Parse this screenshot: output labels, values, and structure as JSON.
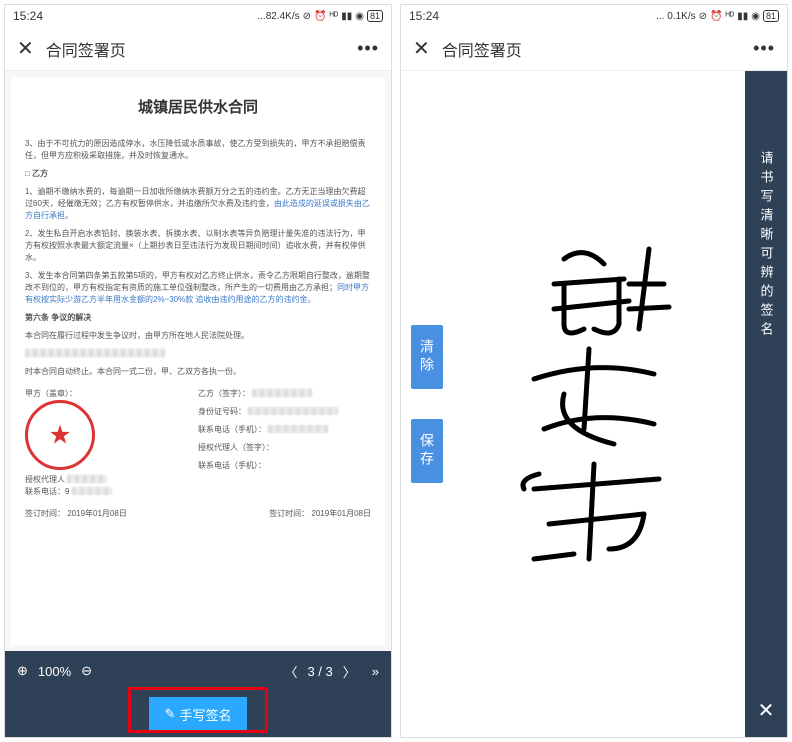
{
  "left": {
    "status": {
      "time": "15:24",
      "speed": "...82.4K/s",
      "battery": "81"
    },
    "header": {
      "title": "合同签署页"
    },
    "doc": {
      "title": "城镇居民供水合同",
      "para1": "3、由于不可抗力的原因造成停水，水压降低或水质事故，使乙方受到损失的，甲方不承担赔偿责任，但甲方应积极采取措施，并及时恢复通水。",
      "sectionLabel": "□ 乙方",
      "para2a": "1、逾期不缴纳水费的，每逾期一日加收所缴纳水费额万分之五的违约金。乙方无正当理由欠费超过60天，经催缴无效；乙方有权暂停供水，并追缴所欠水费及违约金，",
      "para2b": "由此造成的延误或损失由乙方自行承担。",
      "para3a": "2、发生私自开启水表铅封、换装水表、拆换水表、以制水表等异负赔理计量失准的违法行为，甲方有权按照水表最大额定流量×（上期抄表日至违法行为发现日期间时间）追收水费，并有权停供水。",
      "para4a": "3、发生本合同第四条第五款第5项的，甲方有权对乙方终止供水，责令乙方限期自行整改，逾期整改不到位的，甲方有权指定有资质的施工单位强制整改，所产生的一切费用由乙方承担；",
      "para4b": "同时甲方有权按实际少游乙方半年用水金额的2%~30%款 追收由违约用途的乙方的违约金。",
      "article6": "第六条  争议的解决",
      "para5": "本合同在履行过程中发生争议时，由甲方所在地人民法院处理。",
      "para6": "时本合同自动终止。本合同一式二份，甲、乙双方各执一份。",
      "partyA": "甲方（盖章）：",
      "partyB": "乙方（签字）：",
      "idLabel": "身份证号码：",
      "repA": "授权代理人",
      "contactLabel": "联系电话（手机）：",
      "contactA": "联系电话：9",
      "repB": "授权代理人（签字）：",
      "contactB": "联系电话（手机）：",
      "dateA": "签订时间：  2019年01月08日",
      "dateB": "签订时间：  2019年01月08日"
    },
    "viewer": {
      "zoom": "100%",
      "page": "3 / 3",
      "signBtn": "手写签名"
    }
  },
  "right": {
    "status": {
      "time": "15:24",
      "speed": "... 0.1K/s",
      "battery": "81"
    },
    "header": {
      "title": "合同签署页"
    },
    "buttons": {
      "clear": "清除",
      "save": "保存"
    },
    "hint": "请书写清晰可辨的签名"
  }
}
